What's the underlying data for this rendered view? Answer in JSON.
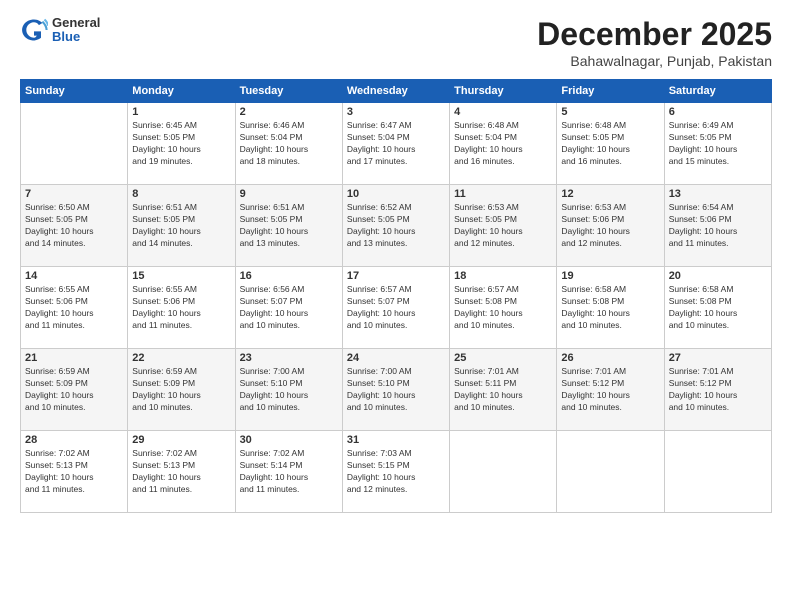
{
  "logo": {
    "general": "General",
    "blue": "Blue"
  },
  "title": "December 2025",
  "location": "Bahawalnagar, Punjab, Pakistan",
  "headers": [
    "Sunday",
    "Monday",
    "Tuesday",
    "Wednesday",
    "Thursday",
    "Friday",
    "Saturday"
  ],
  "weeks": [
    [
      {
        "date": "",
        "info": ""
      },
      {
        "date": "1",
        "info": "Sunrise: 6:45 AM\nSunset: 5:05 PM\nDaylight: 10 hours\nand 19 minutes."
      },
      {
        "date": "2",
        "info": "Sunrise: 6:46 AM\nSunset: 5:04 PM\nDaylight: 10 hours\nand 18 minutes."
      },
      {
        "date": "3",
        "info": "Sunrise: 6:47 AM\nSunset: 5:04 PM\nDaylight: 10 hours\nand 17 minutes."
      },
      {
        "date": "4",
        "info": "Sunrise: 6:48 AM\nSunset: 5:04 PM\nDaylight: 10 hours\nand 16 minutes."
      },
      {
        "date": "5",
        "info": "Sunrise: 6:48 AM\nSunset: 5:05 PM\nDaylight: 10 hours\nand 16 minutes."
      },
      {
        "date": "6",
        "info": "Sunrise: 6:49 AM\nSunset: 5:05 PM\nDaylight: 10 hours\nand 15 minutes."
      }
    ],
    [
      {
        "date": "7",
        "info": "Sunrise: 6:50 AM\nSunset: 5:05 PM\nDaylight: 10 hours\nand 14 minutes."
      },
      {
        "date": "8",
        "info": "Sunrise: 6:51 AM\nSunset: 5:05 PM\nDaylight: 10 hours\nand 14 minutes."
      },
      {
        "date": "9",
        "info": "Sunrise: 6:51 AM\nSunset: 5:05 PM\nDaylight: 10 hours\nand 13 minutes."
      },
      {
        "date": "10",
        "info": "Sunrise: 6:52 AM\nSunset: 5:05 PM\nDaylight: 10 hours\nand 13 minutes."
      },
      {
        "date": "11",
        "info": "Sunrise: 6:53 AM\nSunset: 5:05 PM\nDaylight: 10 hours\nand 12 minutes."
      },
      {
        "date": "12",
        "info": "Sunrise: 6:53 AM\nSunset: 5:06 PM\nDaylight: 10 hours\nand 12 minutes."
      },
      {
        "date": "13",
        "info": "Sunrise: 6:54 AM\nSunset: 5:06 PM\nDaylight: 10 hours\nand 11 minutes."
      }
    ],
    [
      {
        "date": "14",
        "info": "Sunrise: 6:55 AM\nSunset: 5:06 PM\nDaylight: 10 hours\nand 11 minutes."
      },
      {
        "date": "15",
        "info": "Sunrise: 6:55 AM\nSunset: 5:06 PM\nDaylight: 10 hours\nand 11 minutes."
      },
      {
        "date": "16",
        "info": "Sunrise: 6:56 AM\nSunset: 5:07 PM\nDaylight: 10 hours\nand 10 minutes."
      },
      {
        "date": "17",
        "info": "Sunrise: 6:57 AM\nSunset: 5:07 PM\nDaylight: 10 hours\nand 10 minutes."
      },
      {
        "date": "18",
        "info": "Sunrise: 6:57 AM\nSunset: 5:08 PM\nDaylight: 10 hours\nand 10 minutes."
      },
      {
        "date": "19",
        "info": "Sunrise: 6:58 AM\nSunset: 5:08 PM\nDaylight: 10 hours\nand 10 minutes."
      },
      {
        "date": "20",
        "info": "Sunrise: 6:58 AM\nSunset: 5:08 PM\nDaylight: 10 hours\nand 10 minutes."
      }
    ],
    [
      {
        "date": "21",
        "info": "Sunrise: 6:59 AM\nSunset: 5:09 PM\nDaylight: 10 hours\nand 10 minutes."
      },
      {
        "date": "22",
        "info": "Sunrise: 6:59 AM\nSunset: 5:09 PM\nDaylight: 10 hours\nand 10 minutes."
      },
      {
        "date": "23",
        "info": "Sunrise: 7:00 AM\nSunset: 5:10 PM\nDaylight: 10 hours\nand 10 minutes."
      },
      {
        "date": "24",
        "info": "Sunrise: 7:00 AM\nSunset: 5:10 PM\nDaylight: 10 hours\nand 10 minutes."
      },
      {
        "date": "25",
        "info": "Sunrise: 7:01 AM\nSunset: 5:11 PM\nDaylight: 10 hours\nand 10 minutes."
      },
      {
        "date": "26",
        "info": "Sunrise: 7:01 AM\nSunset: 5:12 PM\nDaylight: 10 hours\nand 10 minutes."
      },
      {
        "date": "27",
        "info": "Sunrise: 7:01 AM\nSunset: 5:12 PM\nDaylight: 10 hours\nand 10 minutes."
      }
    ],
    [
      {
        "date": "28",
        "info": "Sunrise: 7:02 AM\nSunset: 5:13 PM\nDaylight: 10 hours\nand 11 minutes."
      },
      {
        "date": "29",
        "info": "Sunrise: 7:02 AM\nSunset: 5:13 PM\nDaylight: 10 hours\nand 11 minutes."
      },
      {
        "date": "30",
        "info": "Sunrise: 7:02 AM\nSunset: 5:14 PM\nDaylight: 10 hours\nand 11 minutes."
      },
      {
        "date": "31",
        "info": "Sunrise: 7:03 AM\nSunset: 5:15 PM\nDaylight: 10 hours\nand 12 minutes."
      },
      {
        "date": "",
        "info": ""
      },
      {
        "date": "",
        "info": ""
      },
      {
        "date": "",
        "info": ""
      }
    ]
  ]
}
